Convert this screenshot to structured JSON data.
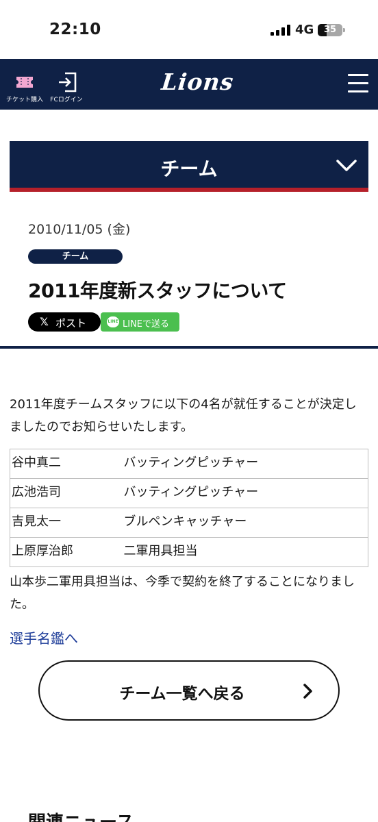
{
  "status_bar": {
    "time": "22:10",
    "network": "4G",
    "battery": "35"
  },
  "header": {
    "ticket_label": "チケット購入",
    "fc_login_label": "FCログイン",
    "logo_text": "Lions",
    "icons": [
      "ticket-icon",
      "login-icon",
      "hamburger-menu-icon"
    ]
  },
  "category": {
    "title": "チーム"
  },
  "article": {
    "date": "2010/11/05 (金)",
    "tag": "チーム",
    "title": "2011年度新スタッフについて",
    "share_x_glyph": "𝕏",
    "share_x_label": "ポスト",
    "share_line_icon": "LINE",
    "share_line_label": "LINEで送る",
    "intro": "2011年度チームスタッフに以下の4名が就任することが決定しましたのでお知らせいたします。",
    "staff": [
      {
        "name": "谷中真二",
        "role": "バッティングピッチャー"
      },
      {
        "name": "広池浩司",
        "role": "バッティングピッチャー"
      },
      {
        "name": "吉見太一",
        "role": "ブルペンキャッチャー"
      },
      {
        "name": "上原厚治郎",
        "role": "二軍用具担当"
      }
    ],
    "outro": "山本歩二軍用具担当は、今季で契約を終了することになりました。",
    "roster_link": "選手名鑑へ"
  },
  "back_button": {
    "label": "チーム一覧へ戻る"
  },
  "related": {
    "heading": "関連ニュース"
  },
  "colors": {
    "navy": "#0f2146",
    "red_accent": "#b5202a",
    "ticket_pink": "#f2a7d1",
    "line_green": "#4bbf4f",
    "link_blue": "#1e3d99"
  }
}
